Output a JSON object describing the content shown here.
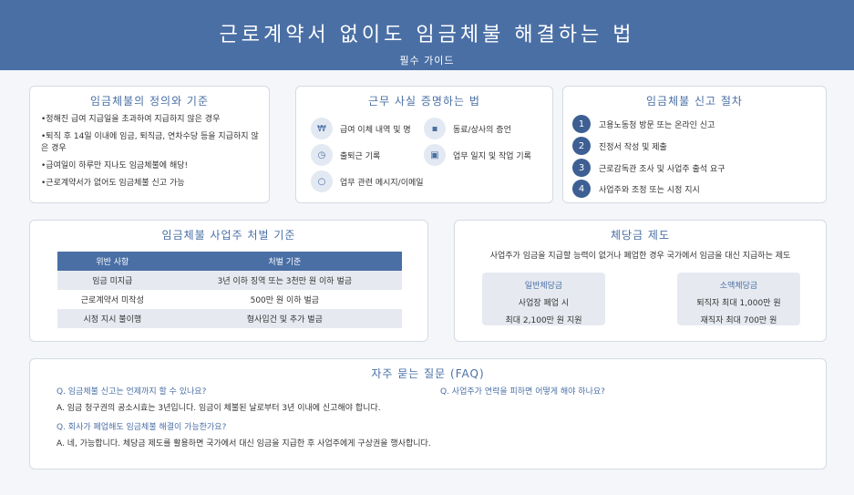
{
  "header": {
    "title": "근로계약서 없이도 임금체불 해결하는 법",
    "subtitle": "필수 가이드"
  },
  "definition": {
    "title": "임금체불의 정의와 기준",
    "items": [
      "•정해진 급여 지급일을 초과하여 지급하지 않은 경우",
      "•퇴직 후 14일 이내에 임금, 퇴직금, 연차수당 등을 지급하지 않은 경우",
      "•급여일이 하루만 지나도 임금체불에 해당!",
      "•근로계약서가 없어도 임금체불 신고 가능"
    ]
  },
  "evidence": {
    "title": "근무 사실 증명하는 법",
    "items": [
      {
        "icon": "won-icon",
        "glyph": "₩",
        "label": "급여 이체 내역 및 명"
      },
      {
        "icon": "people-icon",
        "glyph": "▪",
        "label": "동료/상사의 증언"
      },
      {
        "icon": "clock-icon",
        "glyph": "◷",
        "label": "출퇴근 기록"
      },
      {
        "icon": "document-icon",
        "glyph": "▣",
        "label": "업무 일지 및 작업 기록"
      },
      {
        "icon": "chat-icon",
        "glyph": "○",
        "label": "업무 관련 메시지/이메일"
      }
    ]
  },
  "report": {
    "title": "임금체불 신고 절차",
    "steps": [
      {
        "num": "1",
        "label": "고용노동청 방문 또는 온라인 신고"
      },
      {
        "num": "2",
        "label": "진정서 작성 및 제출"
      },
      {
        "num": "3",
        "label": "근로감독관 조사 및 사업주 출석 요구"
      },
      {
        "num": "4",
        "label": "사업주와 조정 또는 시정 지시"
      }
    ]
  },
  "penalty": {
    "title": "임금체불 사업주 처벌 기준",
    "headers": [
      "위반 사항",
      "처벌 기준"
    ],
    "rows": [
      [
        "임금 미지급",
        "3년 이하 징역 또는 3천만 원 이하 벌금"
      ],
      [
        "근로계약서 미작성",
        "500만 원 이하 벌금"
      ],
      [
        "시정 지시 불이행",
        "형사입건 및 추가 벌금"
      ]
    ]
  },
  "substitute": {
    "title": "체당금 제도",
    "description": "사업주가 임금을 지급할 능력이 없거나 폐업한 경우 국가에서 임금을 대신 지급하는 제도",
    "general": {
      "title": "일반체당금",
      "line1": "사업장 폐업 시",
      "line2": "최대 2,100만 원 지원"
    },
    "small": {
      "title": "소액체당금",
      "line1": "퇴직자 최대 1,000만 원",
      "line2": "재직자 최대 700만 원"
    }
  },
  "faq": {
    "title": "자주 묻는 질문 (FAQ)",
    "items": [
      {
        "q": "Q. 임금체불 신고는 언제까지 할 수 있나요?",
        "a": "A. 임금 청구권의 공소시효는 3년입니다. 임금이 체불된 날로부터 3년 이내에 신고해야 합니다."
      },
      {
        "q": "Q. 사업주가 연락을 피하면 어떻게 해야 하나요?",
        "a": ""
      },
      {
        "q": "Q. 회사가 폐업해도 임금체불 해결이 가능한가요?",
        "a": "A. 네, 가능합니다. 체당금 제도를 활용하면 국가에서 대신 임금을 지급한 후 사업주에게 구상권을 행사합니다."
      }
    ]
  }
}
